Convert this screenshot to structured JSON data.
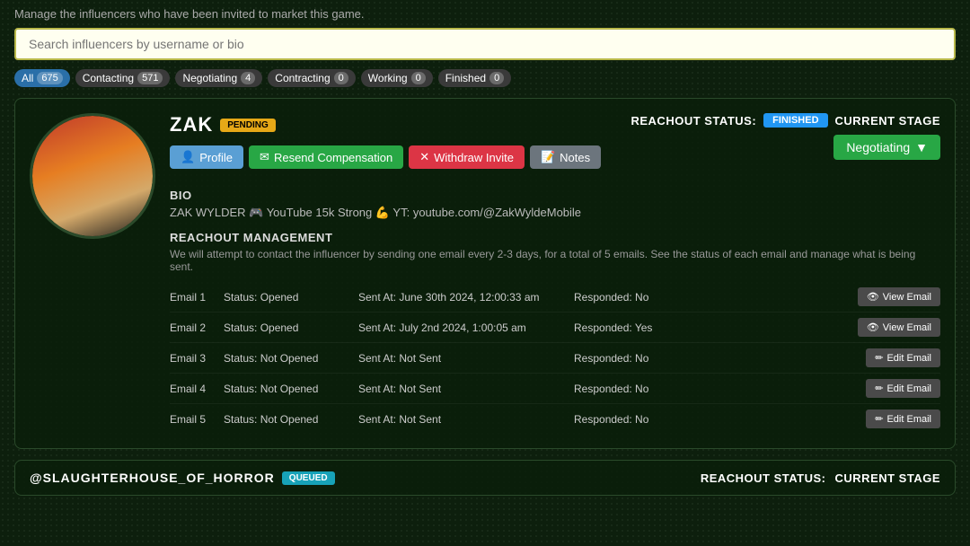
{
  "page": {
    "manage_text": "Manage the influencers who have been invited to market this game."
  },
  "search": {
    "placeholder": "Search influencers by username or bio",
    "value": ""
  },
  "filters": [
    {
      "id": "all",
      "label": "All",
      "count": "675",
      "active": true
    },
    {
      "id": "contacting",
      "label": "Contacting",
      "count": "571",
      "active": false
    },
    {
      "id": "negotiating",
      "label": "Negotiating",
      "count": "4",
      "active": false
    },
    {
      "id": "contracting",
      "label": "Contracting",
      "count": "0",
      "active": false
    },
    {
      "id": "working",
      "label": "Working",
      "count": "0",
      "active": false
    },
    {
      "id": "finished",
      "label": "Finished",
      "count": "0",
      "active": false
    }
  ],
  "card": {
    "name": "ZAK",
    "status_badge": "PENDING",
    "reachout_label": "REACHOUT STATUS:",
    "reachout_status": "FINISHED",
    "current_stage_label": "CURRENT STAGE",
    "stage_value": "Negotiating",
    "buttons": {
      "profile": "Profile",
      "resend": "Resend Compensation",
      "withdraw": "Withdraw Invite",
      "notes": "Notes"
    },
    "bio_label": "BIO",
    "bio_text": "ZAK WYLDER 🎮 YouTube 15k Strong 💪 YT: youtube.com/@ZakWyldeMobile",
    "reachout_mgmt_label": "REACHOUT MANAGEMENT",
    "reachout_mgmt_desc": "We will attempt to contact the influencer by sending one email every 2-3 days, for a total of 5 emails. See the status of each email and manage what is being sent.",
    "emails": [
      {
        "label": "Email 1",
        "status": "Status: Opened",
        "sent_at": "Sent At: June 30th 2024, 12:00:33 am",
        "responded": "Responded: No",
        "action": "View Email",
        "action_type": "view"
      },
      {
        "label": "Email 2",
        "status": "Status: Opened",
        "sent_at": "Sent At: July 2nd 2024, 1:00:05 am",
        "responded": "Responded: Yes",
        "action": "View Email",
        "action_type": "view"
      },
      {
        "label": "Email 3",
        "status": "Status: Not Opened",
        "sent_at": "Sent At: Not Sent",
        "responded": "Responded: No",
        "action": "Edit Email",
        "action_type": "edit"
      },
      {
        "label": "Email 4",
        "status": "Status: Not Opened",
        "sent_at": "Sent At: Not Sent",
        "responded": "Responded: No",
        "action": "Edit Email",
        "action_type": "edit"
      },
      {
        "label": "Email 5",
        "status": "Status: Not Opened",
        "sent_at": "Sent At: Not Sent",
        "responded": "Responded: No",
        "action": "Edit Email",
        "action_type": "edit"
      }
    ]
  },
  "partial_card": {
    "name": "@SLAUGHTERHOUSE_OF_HORROR",
    "status_badge": "QUEUED",
    "reachout_label": "REACHOUT STATUS:",
    "current_stage_label": "CURRENT STAGE"
  },
  "icons": {
    "person": "👤",
    "email": "✉",
    "x": "✕",
    "note": "📝",
    "eye": "👁",
    "pencil": "✏",
    "chevron_down": "▼"
  }
}
